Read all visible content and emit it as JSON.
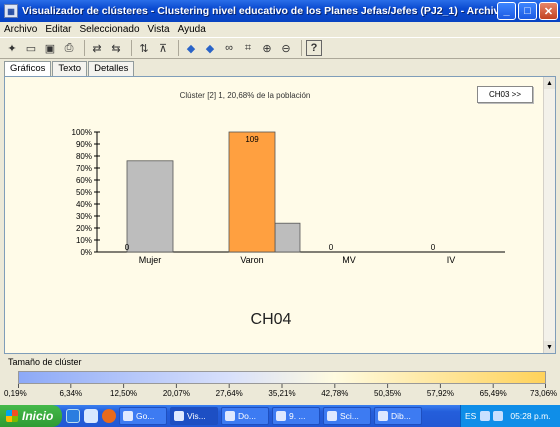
{
  "window": {
    "title": "Visualizador de clústeres - Clustering nivel educativo de los Planes Jefas/Jefes (PJ2_1) - Archivo local: general I...",
    "minimize": "_",
    "maximize": "□",
    "close": "✕"
  },
  "menu": [
    "Archivo",
    "Editar",
    "Seleccionado",
    "Vista",
    "Ayuda"
  ],
  "toolbar_icons": [
    "new-icon",
    "open-icon",
    "save-icon",
    "print-icon",
    "refresh-icon",
    "redo-icon",
    "sort-icon",
    "filter-icon",
    "arrow-left-icon",
    "arrow-right-icon",
    "binoculars-icon",
    "chart-icon",
    "zoom-in-icon",
    "zoom-out-icon",
    "help-icon"
  ],
  "tabs": [
    "Gráficos",
    "Texto",
    "Detalles"
  ],
  "panel": {
    "cluster_title": "Clúster [2] 1, 20,68% de la población",
    "next_button": "CH03 >>",
    "characteristic": "CH04"
  },
  "chart_data": {
    "type": "bar",
    "categories": [
      "Mujer",
      "Varon",
      "MV",
      "IV"
    ],
    "series": [
      {
        "values": [
          0,
          100,
          0,
          0
        ],
        "color": "#ffa040"
      },
      {
        "values": [
          76,
          24,
          0,
          0
        ],
        "color": "#bdbdbd"
      }
    ],
    "data_labels": [
      "0",
      "109",
      "0",
      "0"
    ],
    "ylim": [
      0,
      100
    ],
    "yticks": [
      "0%",
      "10%",
      "20%",
      "30%",
      "40%",
      "50%",
      "60%",
      "70%",
      "80%",
      "90%",
      "100%"
    ]
  },
  "cluster_size": {
    "label": "Tamaño de clúster",
    "ticks": [
      "0,19%",
      "6,34%",
      "12,50%",
      "20,07%",
      "27,64%",
      "35,21%",
      "42,78%",
      "50,35%",
      "57,92%",
      "65,49%",
      "73,06%"
    ]
  },
  "taskbar": {
    "start": "Inicio",
    "tasks": [
      "Go...",
      "Vis...",
      "Do...",
      "9. ...",
      "Sci...",
      "Dib..."
    ],
    "tray_lang": "ES",
    "clock": "05:28 p.m."
  },
  "colors": {
    "titlebar": "#0a4ad0",
    "panel_bg": "#fffbe8",
    "highlight_bar": "#ffa040",
    "reference_bar": "#bdbdbd"
  }
}
